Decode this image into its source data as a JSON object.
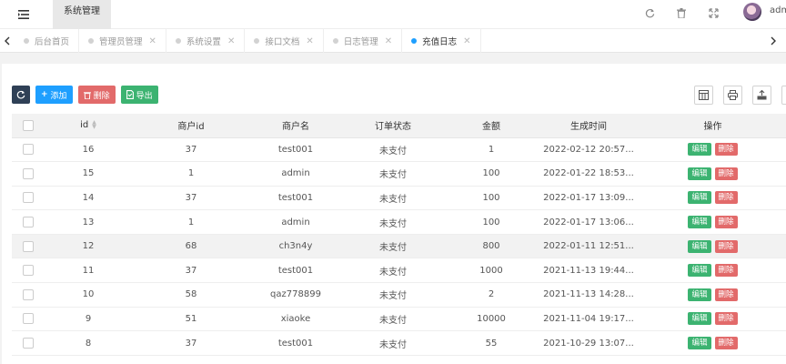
{
  "topbar": {
    "menu_icon": "menu-toggle-icon",
    "nav_label": "系统管理",
    "icons": [
      "refresh-icon",
      "trash-icon",
      "fullscreen-icon"
    ],
    "username": "adm"
  },
  "tabs": {
    "items": [
      {
        "label": "后台首页",
        "closable": false,
        "active": false
      },
      {
        "label": "管理员管理",
        "closable": true,
        "active": false
      },
      {
        "label": "系统设置",
        "closable": true,
        "active": false
      },
      {
        "label": "接口文档",
        "closable": true,
        "active": false
      },
      {
        "label": "日志管理",
        "closable": true,
        "active": false
      },
      {
        "label": "充值日志",
        "closable": true,
        "active": true
      }
    ]
  },
  "toolbar": {
    "add_label": "添加",
    "delete_label": "删除",
    "export_label": "导出",
    "right_icons": [
      "columns-icon",
      "print-icon",
      "export-icon",
      "search-icon"
    ]
  },
  "table": {
    "headers": [
      "id",
      "商户id",
      "商户名",
      "订单状态",
      "金额",
      "生成时间",
      "操作"
    ],
    "edit_label": "编辑",
    "delete_label": "删除",
    "rows": [
      {
        "id": "16",
        "mid": "37",
        "name": "test001",
        "status": "未支付",
        "amount": "1",
        "time": "2022-02-12 20:57..."
      },
      {
        "id": "15",
        "mid": "1",
        "name": "admin",
        "status": "未支付",
        "amount": "100",
        "time": "2022-01-22 18:53..."
      },
      {
        "id": "14",
        "mid": "37",
        "name": "test001",
        "status": "未支付",
        "amount": "100",
        "time": "2022-01-17 13:09..."
      },
      {
        "id": "13",
        "mid": "1",
        "name": "admin",
        "status": "未支付",
        "amount": "100",
        "time": "2022-01-17 13:06..."
      },
      {
        "id": "12",
        "mid": "68",
        "name": "ch3n4y",
        "status": "未支付",
        "amount": "800",
        "time": "2022-01-11 12:51..."
      },
      {
        "id": "11",
        "mid": "37",
        "name": "test001",
        "status": "未支付",
        "amount": "1000",
        "time": "2021-11-13 19:44..."
      },
      {
        "id": "10",
        "mid": "58",
        "name": "qaz778899",
        "status": "未支付",
        "amount": "2",
        "time": "2021-11-13 14:28..."
      },
      {
        "id": "9",
        "mid": "51",
        "name": "xiaoke",
        "status": "未支付",
        "amount": "10000",
        "time": "2021-11-04 19:17..."
      },
      {
        "id": "8",
        "mid": "37",
        "name": "test001",
        "status": "未支付",
        "amount": "55",
        "time": "2021-10-29 13:07..."
      }
    ]
  }
}
